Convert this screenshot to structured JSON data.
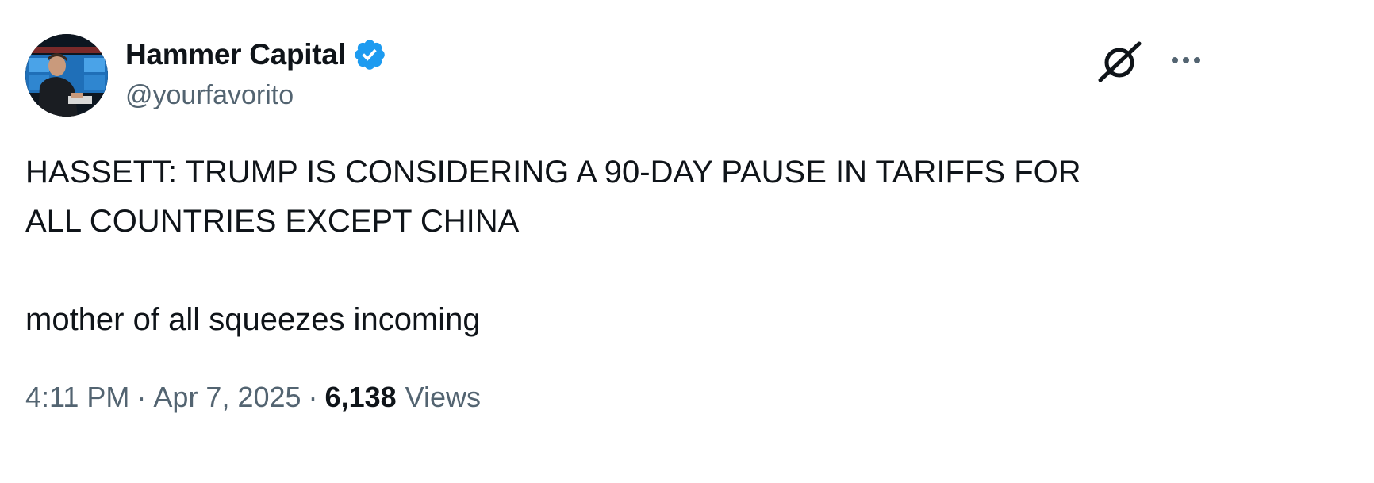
{
  "author": {
    "display_name": "Hammer Capital",
    "handle": "@yourfavorito",
    "verified": true,
    "verified_color": "#1d9bf0"
  },
  "tweet": {
    "headline_line1": "HASSETT: TRUMP IS CONSIDERING A 90-DAY PAUSE IN TARIFFS FOR",
    "headline_line2": "ALL COUNTRIES EXCEPT CHINA",
    "comment": "mother of all squeezes incoming"
  },
  "meta": {
    "time": "4:11 PM",
    "separator": "·",
    "date": "Apr 7, 2025",
    "views_count": "6,138",
    "views_label": "Views"
  },
  "icons": {
    "grok": "grok-icon",
    "more": "more-options-icon",
    "verified": "verified-badge-icon"
  },
  "colors": {
    "text_primary": "#0f1419",
    "text_secondary": "#536471",
    "background": "#ffffff"
  }
}
